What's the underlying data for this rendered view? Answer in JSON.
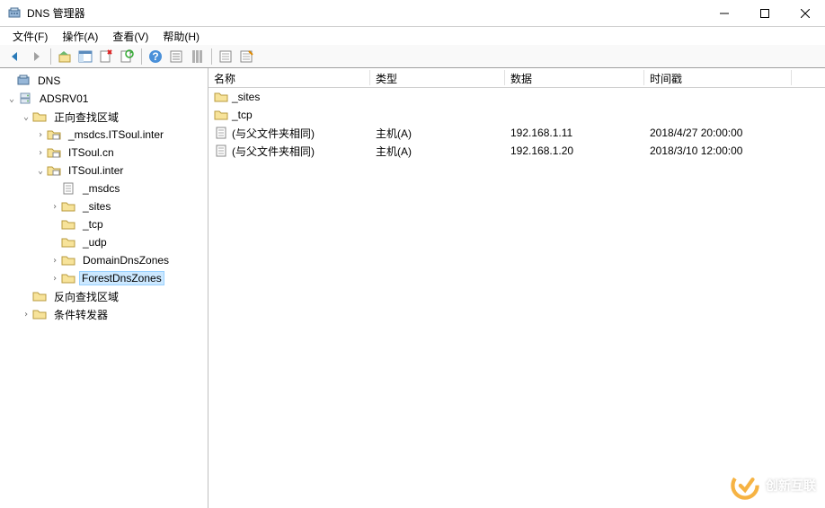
{
  "window": {
    "title": "DNS 管理器"
  },
  "menu": {
    "file": "文件(F)",
    "action": "操作(A)",
    "view": "查看(V)",
    "help": "帮助(H)"
  },
  "tree": {
    "root": "DNS",
    "server": "ADSRV01",
    "fwd_zone": "正向查找区域",
    "zone_msdcs": "_msdcs.ITSoul.inter",
    "zone_cn": "ITSoul.cn",
    "zone_inter": "ITSoul.inter",
    "sub_msdcs": "_msdcs",
    "sub_sites": "_sites",
    "sub_tcp": "_tcp",
    "sub_udp": "_udp",
    "sub_domaindns": "DomainDnsZones",
    "sub_forestdns": "ForestDnsZones",
    "rev_zone": "反向查找区域",
    "cond_fwd": "条件转发器"
  },
  "columns": {
    "name": "名称",
    "type": "类型",
    "data": "数据",
    "timestamp": "时间戳"
  },
  "records": [
    {
      "icon": "folder",
      "name": "_sites",
      "type": "",
      "data": "",
      "ts": ""
    },
    {
      "icon": "folder",
      "name": "_tcp",
      "type": "",
      "data": "",
      "ts": ""
    },
    {
      "icon": "record",
      "name": "(与父文件夹相同)",
      "type": "主机(A)",
      "data": "192.168.1.11",
      "ts": "2018/4/27 20:00:00"
    },
    {
      "icon": "record",
      "name": "(与父文件夹相同)",
      "type": "主机(A)",
      "data": "192.168.1.20",
      "ts": "2018/3/10 12:00:00"
    }
  ],
  "watermark": "创新互联"
}
